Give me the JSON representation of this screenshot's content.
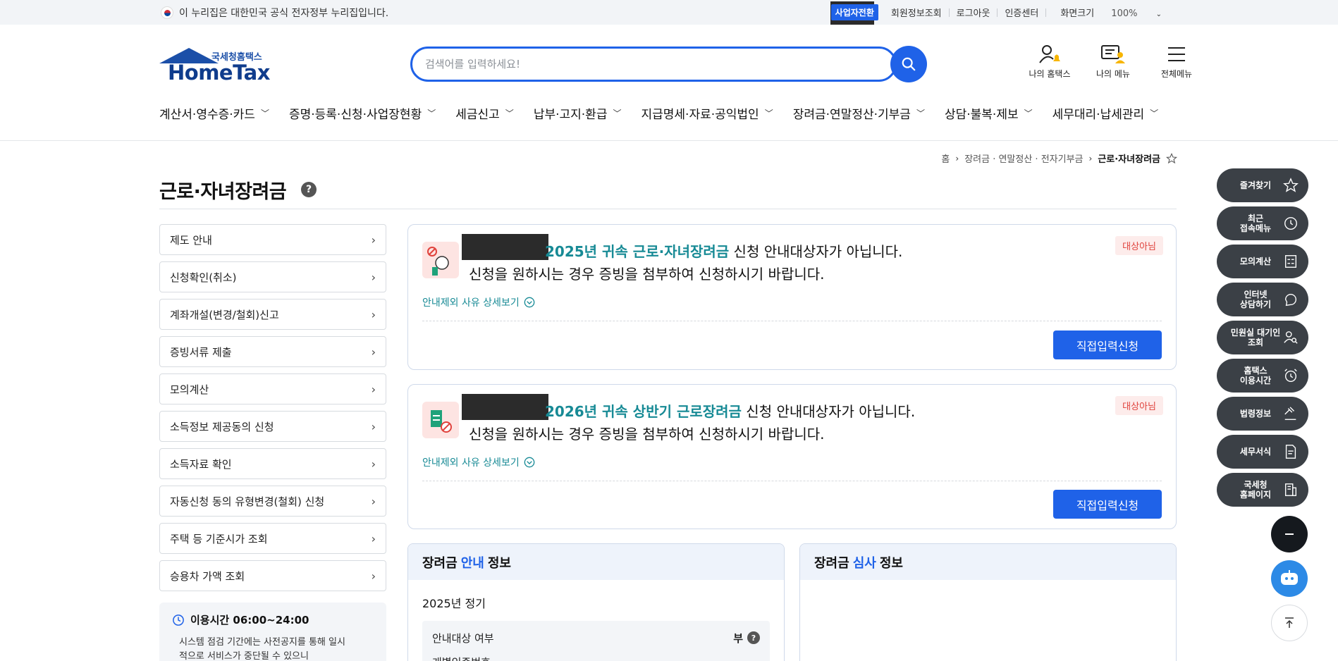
{
  "topbar": {
    "gov_notice": "이 누리집은 대한민국 공식 전자정부 누리집입니다.",
    "biz_switch": "사업자전환",
    "links": [
      "회원정보조회",
      "로그아웃",
      "인증센터"
    ],
    "zoom_label": "화면크기",
    "zoom_value": "100%"
  },
  "logo": {
    "small": "국세청홈택스",
    "big": "HomeTax"
  },
  "search": {
    "placeholder": "검색어를 입력하세요!"
  },
  "header_icons": [
    {
      "label": "나의 홈택스",
      "icon": "user-bell-icon"
    },
    {
      "label": "나의 메뉴",
      "icon": "my-menu-icon"
    },
    {
      "label": "전체메뉴",
      "icon": "hamburger-icon"
    }
  ],
  "gnb": [
    "계산서·영수증·카드",
    "증명·등록·신청·사업장현황",
    "세금신고",
    "납부·고지·환급",
    "지급명세·자료·공익법인",
    "장려금·연말정산·기부금",
    "상담·불복·제보",
    "세무대리·납세관리"
  ],
  "breadcrumb": [
    "홈",
    "장려금 · 연말정산 · 전자기부금",
    "근로·자녀장려금"
  ],
  "page_title": "근로·자녀장려금",
  "left_menu": [
    "제도 안내",
    "신청확인(취소)",
    "계좌개설(변경/철회)신고",
    "증빙서류 제출",
    "모의계산",
    "소득정보 제공동의 신청",
    "소득자료 확인",
    "자동신청 동의 유형변경(철회) 신청",
    "주택 등 기준시가 조회",
    "승용차 가액 조회"
  ],
  "time_box": {
    "title": "이용시간 06:00~24:00",
    "desc": "시스템 점검 기간에는 사전공지를 통해 일시적으로 서비스가 중단될 수 있으니"
  },
  "cards": [
    {
      "highlight": "2025년 귀속 근로·자녀장려금",
      "line1_rest": " 신청 안내대상자가 아닙니다.",
      "line2": "신청을 원하시는 경우 증빙을 첨부하여 신청하시기 바랍니다.",
      "tag": "대상아님",
      "more": "안내제외 사유 상세보기",
      "button": "직접입력신청"
    },
    {
      "highlight": "2026년 귀속 상반기 근로장려금",
      "line1_rest": " 신청 안내대상자가 아닙니다.",
      "line2": "신청을 원하시는 경우 증빙을 첨부하여 신청하시기 바랍니다.",
      "tag": "대상아님",
      "more": "안내제외 사유 상세보기",
      "button": "직접입력신청"
    }
  ],
  "panels": {
    "guide": {
      "pre": "장려금",
      "blue": "안내",
      "post": "정보",
      "sub": "2025년 정기",
      "rows": [
        {
          "label": "안내대상 여부",
          "value": "부"
        },
        {
          "label": "개별인증번호",
          "value": ""
        }
      ]
    },
    "review": {
      "pre": "장려금",
      "blue": "심사",
      "post": "정보"
    }
  },
  "quick_menu": [
    {
      "label": "즐겨찾기",
      "icon": "star-icon"
    },
    {
      "label": "최근\n접속메뉴",
      "icon": "clock-icon"
    },
    {
      "label": "모의계산",
      "icon": "calculator-icon"
    },
    {
      "label": "인터넷\n상담하기",
      "icon": "chat-icon"
    },
    {
      "label": "민원실 대기인\n조회",
      "icon": "person-search-icon"
    },
    {
      "label": "홈택스\n이용시간",
      "icon": "alarm-icon"
    },
    {
      "label": "법령정보",
      "icon": "gavel-icon"
    },
    {
      "label": "세무서식",
      "icon": "document-icon"
    },
    {
      "label": "국세청\n홈페이지",
      "icon": "building-icon"
    }
  ],
  "colors": {
    "primary": "#1f62e8",
    "teal": "#178a95",
    "tag_red": "#e0423c",
    "quick_bg": "#3b4046"
  }
}
